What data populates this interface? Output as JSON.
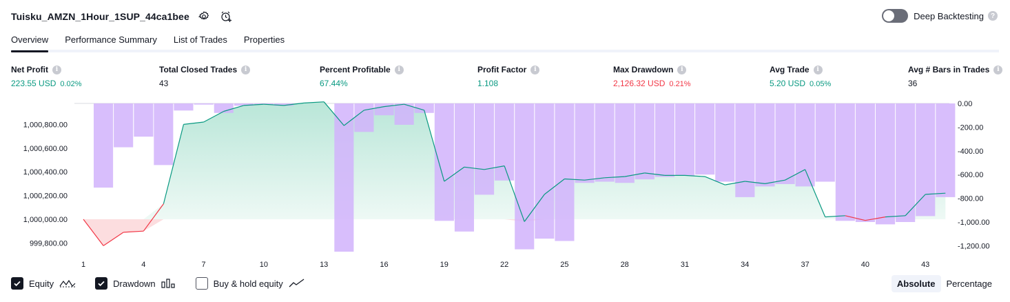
{
  "header": {
    "strategy_name": "Tuisku_AMZN_1Hour_1SUP_44ca1bee",
    "settings_icon": "gear-icon",
    "alert_icon": "alarm-clock-plus-icon",
    "deep_backtesting_label": "Deep Backtesting",
    "deep_backtesting_enabled": false,
    "help_glyph": "?"
  },
  "tabs": [
    {
      "label": "Overview",
      "active": true
    },
    {
      "label": "Performance Summary",
      "active": false
    },
    {
      "label": "List of Trades",
      "active": false
    },
    {
      "label": "Properties",
      "active": false
    }
  ],
  "metrics": [
    {
      "label": "Net Profit",
      "value": "223.55 USD",
      "pct": "0.02%",
      "color": "green"
    },
    {
      "label": "Total Closed Trades",
      "value": "43",
      "pct": "",
      "color": "dark"
    },
    {
      "label": "Percent Profitable",
      "value": "67.44%",
      "pct": "",
      "color": "green"
    },
    {
      "label": "Profit Factor",
      "value": "1.108",
      "pct": "",
      "color": "green"
    },
    {
      "label": "Max Drawdown",
      "value": "2,126.32 USD",
      "pct": "0.21%",
      "color": "red"
    },
    {
      "label": "Avg Trade",
      "value": "5.20 USD",
      "pct": "0.05%",
      "color": "green"
    },
    {
      "label": "Avg # Bars in Trades",
      "value": "36",
      "pct": "",
      "color": "dark"
    }
  ],
  "info_glyph": "i",
  "legend": {
    "equity_label": "Equity",
    "equity_checked": true,
    "drawdown_label": "Drawdown",
    "drawdown_checked": true,
    "buyhold_label": "Buy & hold equity",
    "buyhold_checked": false
  },
  "mode": {
    "absolute_label": "Absolute",
    "percentage_label": "Percentage",
    "active": "Absolute"
  },
  "colors": {
    "equity_line": "#089981",
    "equity_fill": "#cdeee4",
    "loss_line": "#f23645",
    "loss_fill": "#fcd9dc",
    "drawdown_bar": "#d1b3fb",
    "text_green": "#089981",
    "text_red": "#f23645"
  },
  "chart_data": {
    "type": "area",
    "x": [
      1,
      2,
      3,
      4,
      5,
      6,
      7,
      8,
      9,
      10,
      11,
      12,
      13,
      14,
      15,
      16,
      17,
      18,
      19,
      20,
      21,
      22,
      23,
      24,
      25,
      26,
      27,
      28,
      29,
      30,
      31,
      32,
      33,
      34,
      35,
      36,
      37,
      38,
      39,
      40,
      41,
      42,
      43,
      44
    ],
    "x_ticks": [
      "1",
      "4",
      "7",
      "10",
      "13",
      "16",
      "19",
      "22",
      "25",
      "28",
      "31",
      "34",
      "37",
      "40",
      "43"
    ],
    "series": [
      {
        "axis": "left",
        "values": [
          1000000,
          999777,
          999890,
          999900,
          1000130,
          1000800,
          1000820,
          1000910,
          1000960,
          1000970,
          1000960,
          1000980,
          1000990,
          1000790,
          1000920,
          1000950,
          1000970,
          1000920,
          1000320,
          1000440,
          1000420,
          1000450,
          999980,
          1000210,
          1000340,
          1000330,
          1000350,
          1000360,
          1000390,
          1000370,
          1000370,
          1000360,
          1000290,
          1000320,
          1000300,
          1000330,
          1000420,
          1000020,
          1000030,
          999990,
          1000020,
          1000030,
          1000210,
          1000220
        ]
      },
      {
        "axis": "right",
        "values": [
          0,
          -710,
          -370,
          -280,
          -520,
          -60,
          -10,
          -80,
          -20,
          -10,
          -20,
          0,
          0,
          -1250,
          -240,
          -100,
          -180,
          -80,
          -990,
          -1080,
          -770,
          -650,
          -1230,
          -1140,
          -1160,
          -670,
          -660,
          -670,
          -640,
          -620,
          -610,
          -600,
          -660,
          -790,
          -700,
          -680,
          -700,
          -660,
          -990,
          -1000,
          -1020,
          -1000,
          -950,
          -790
        ]
      }
    ],
    "y_left": {
      "min": 999700,
      "max": 1001000,
      "ticks": [
        "1,000,800.00",
        "1,000,600.00",
        "1,000,400.00",
        "1,000,200.00",
        "1,000,000.00",
        "999,800.00"
      ]
    },
    "y_right": {
      "min": -1300,
      "max": 0,
      "ticks": [
        "0.00",
        "-200.00",
        "-400.00",
        "-600.00",
        "-800.00",
        "-1,000.00",
        "-1,200.00"
      ]
    }
  }
}
